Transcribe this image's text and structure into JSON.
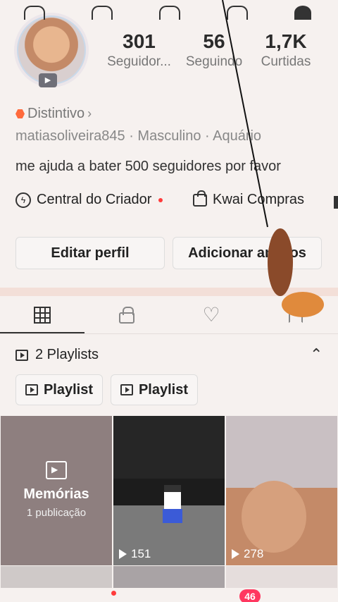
{
  "profile": {
    "stats": [
      {
        "value": "301",
        "label": "Seguidor..."
      },
      {
        "value": "56",
        "label": "Seguindo"
      },
      {
        "value": "1,7K",
        "label": "Curtidas"
      }
    ],
    "badge_label": "Distintivo",
    "meta_line": "matiasoliveira845 · Masculino · Aquário",
    "bio": "me ajuda a bater 500 seguidores por favor",
    "creator_center": "Central do Criador",
    "shop": "Kwai Compras",
    "edit_button": "Editar perfil",
    "add_button": "Adicionar amigos"
  },
  "playlists": {
    "header": "2 Playlists",
    "chips": [
      "Playlist",
      "Playlist"
    ]
  },
  "grid": {
    "memories": {
      "title": "Memórias",
      "subtitle": "1 publicação"
    },
    "views": [
      "151",
      "278"
    ]
  },
  "nav": {
    "notification_count": "46"
  },
  "colors": {
    "accent": "#ff3b3b",
    "badge": "#ff6a3c",
    "notification": "#ff3860"
  }
}
